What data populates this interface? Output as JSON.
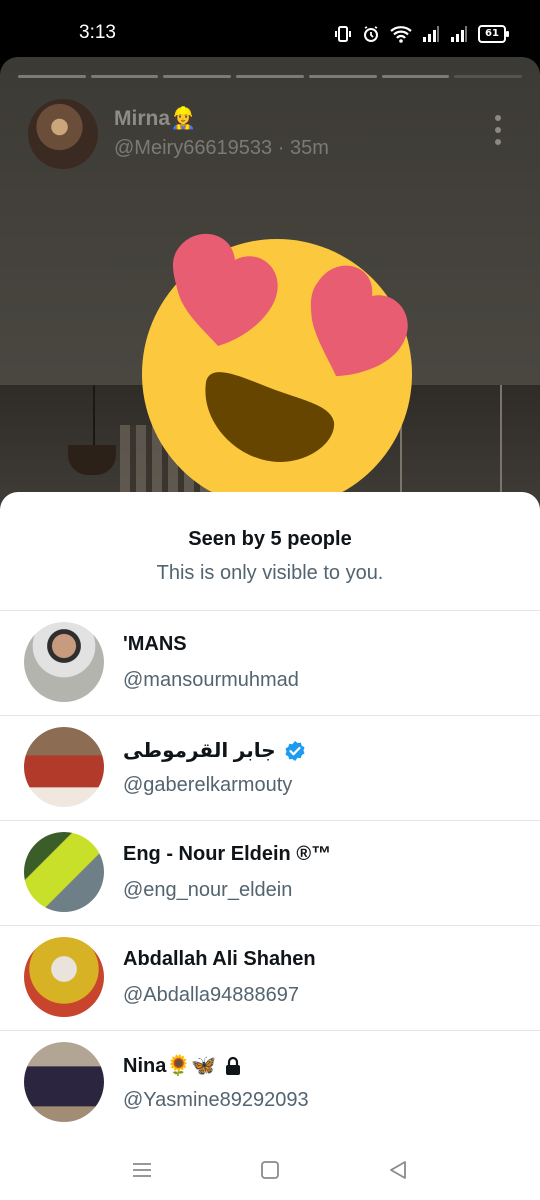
{
  "status_bar": {
    "time": "3:13",
    "battery": "61"
  },
  "story": {
    "author_name": "Mirna👷‍♀️",
    "author_meta": "@Meiry66619533 · 35m",
    "progress_segments": 7,
    "reaction_icon": "heart-eyes-emoji-icon"
  },
  "sheet": {
    "title": "Seen by 5 people",
    "subtitle": "This is only visible to you."
  },
  "viewers": [
    {
      "name": "'MANS",
      "handle": "@mansourmuhmad",
      "verified": false,
      "locked": false
    },
    {
      "name": "جابر القرموطى",
      "handle": "@gaberelkarmouty",
      "verified": true,
      "locked": false
    },
    {
      "name": "Eng - Nour Eldein ®™",
      "handle": "@eng_nour_eldein",
      "verified": false,
      "locked": false
    },
    {
      "name": "Abdallah Ali Shahen",
      "handle": "@Abdalla94888697",
      "verified": false,
      "locked": false
    },
    {
      "name": "Nina🌻🦋",
      "handle": "@Yasmine89292093",
      "verified": false,
      "locked": true
    }
  ],
  "colors": {
    "accent_verified": "#1d9bf0",
    "text_primary": "#0f1419",
    "text_secondary": "#536471"
  }
}
